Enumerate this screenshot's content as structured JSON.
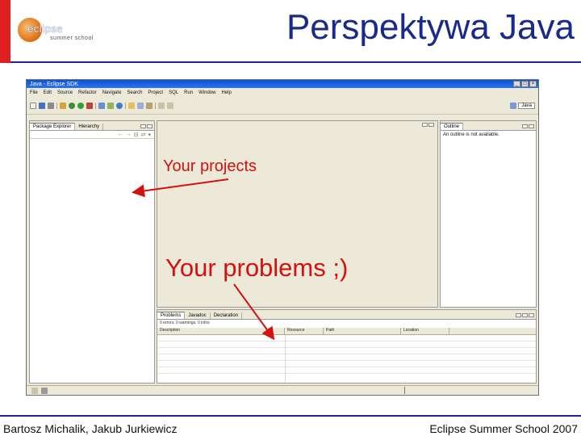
{
  "slide": {
    "title": "Perspektywa Java",
    "footer_left": "Bartosz Michalik, Jakub Jurkiewicz",
    "footer_right": "Eclipse Summer School 2007",
    "accent_color": "#e02020",
    "title_color": "#1a2a8a"
  },
  "logo": {
    "line1": "eclipse",
    "line2": "summer school"
  },
  "window": {
    "title": "Java - Eclipse SDK",
    "buttons": {
      "minimize": "_",
      "maximize": "□",
      "close": "×"
    },
    "menu": [
      "File",
      "Edit",
      "Source",
      "Refactor",
      "Navigate",
      "Search",
      "Project",
      "SQL",
      "Run",
      "Window",
      "Help"
    ],
    "perspective": {
      "java_label": "Java"
    },
    "left_pane": {
      "tabs": [
        {
          "label": "Package Explorer"
        },
        {
          "label": "Hierarchy"
        }
      ]
    },
    "outline_pane": {
      "tab": "Outline",
      "message": "An outline is not available."
    },
    "problems_pane": {
      "tabs": [
        {
          "label": "Problems"
        },
        {
          "label": "Javadoc"
        },
        {
          "label": "Declaration"
        }
      ],
      "summary": "0 errors, 0 warnings, 0 infos",
      "columns": [
        "Description",
        "Resource",
        "Path",
        "Location"
      ]
    }
  },
  "annotations": {
    "projects": "Your projects",
    "problems": "Your problems ;)",
    "color": "#d41010"
  }
}
